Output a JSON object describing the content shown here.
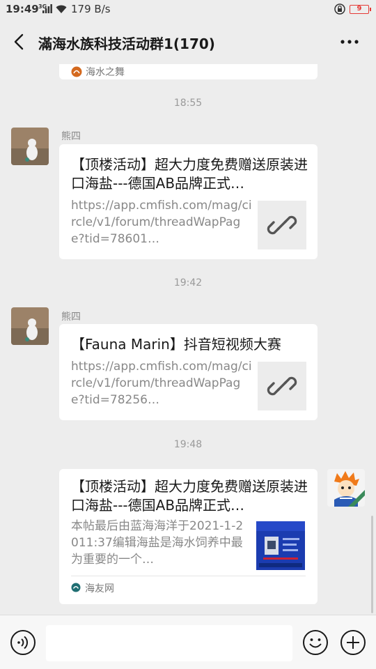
{
  "status_bar": {
    "time": "19:49",
    "signal_label": "3G",
    "speed": "179 B/s",
    "battery": "9",
    "icons": [
      "signal-icon",
      "wifi-icon",
      "lock-icon",
      "battery-icon"
    ]
  },
  "header": {
    "title": "滿海水族科技活动群1(170)",
    "back_icon": "back-arrow-icon",
    "more_icon": "more-icon"
  },
  "chat": {
    "top_partial_source": "海水之舞",
    "messages": [
      {
        "timestamp": "18:55",
        "sender": "熊四",
        "card_title": "【顶楼活动】超大力度免费赠送原装进口海盐---德国AB品牌正式…",
        "card_desc": "https://app.cmfish.com/mag/circle/v1/forum/threadWapPage?tid=78601…",
        "thumb_icon": "link-icon"
      },
      {
        "timestamp": "19:42",
        "sender": "熊四",
        "card_title": "【Fauna Marin】抖音短视频大赛",
        "card_desc": "https://app.cmfish.com/mag/circle/v1/forum/threadWapPage?tid=78256…",
        "thumb_icon": "link-icon"
      },
      {
        "timestamp": "19:48",
        "card_title": "【顶楼活动】超大力度免费赠送原装进口海盐---德国AB品牌正式…",
        "card_desc": "本帖最后由蓝海海洋于2021-1-2011:37编辑海盐是海水饲养中最为重要的一个…",
        "source": "海友网",
        "thumb_icon": "article-thumbnail"
      }
    ]
  },
  "input_bar": {
    "voice_icon": "voice-icon",
    "emoji_icon": "emoji-icon",
    "plus_icon": "plus-icon"
  }
}
